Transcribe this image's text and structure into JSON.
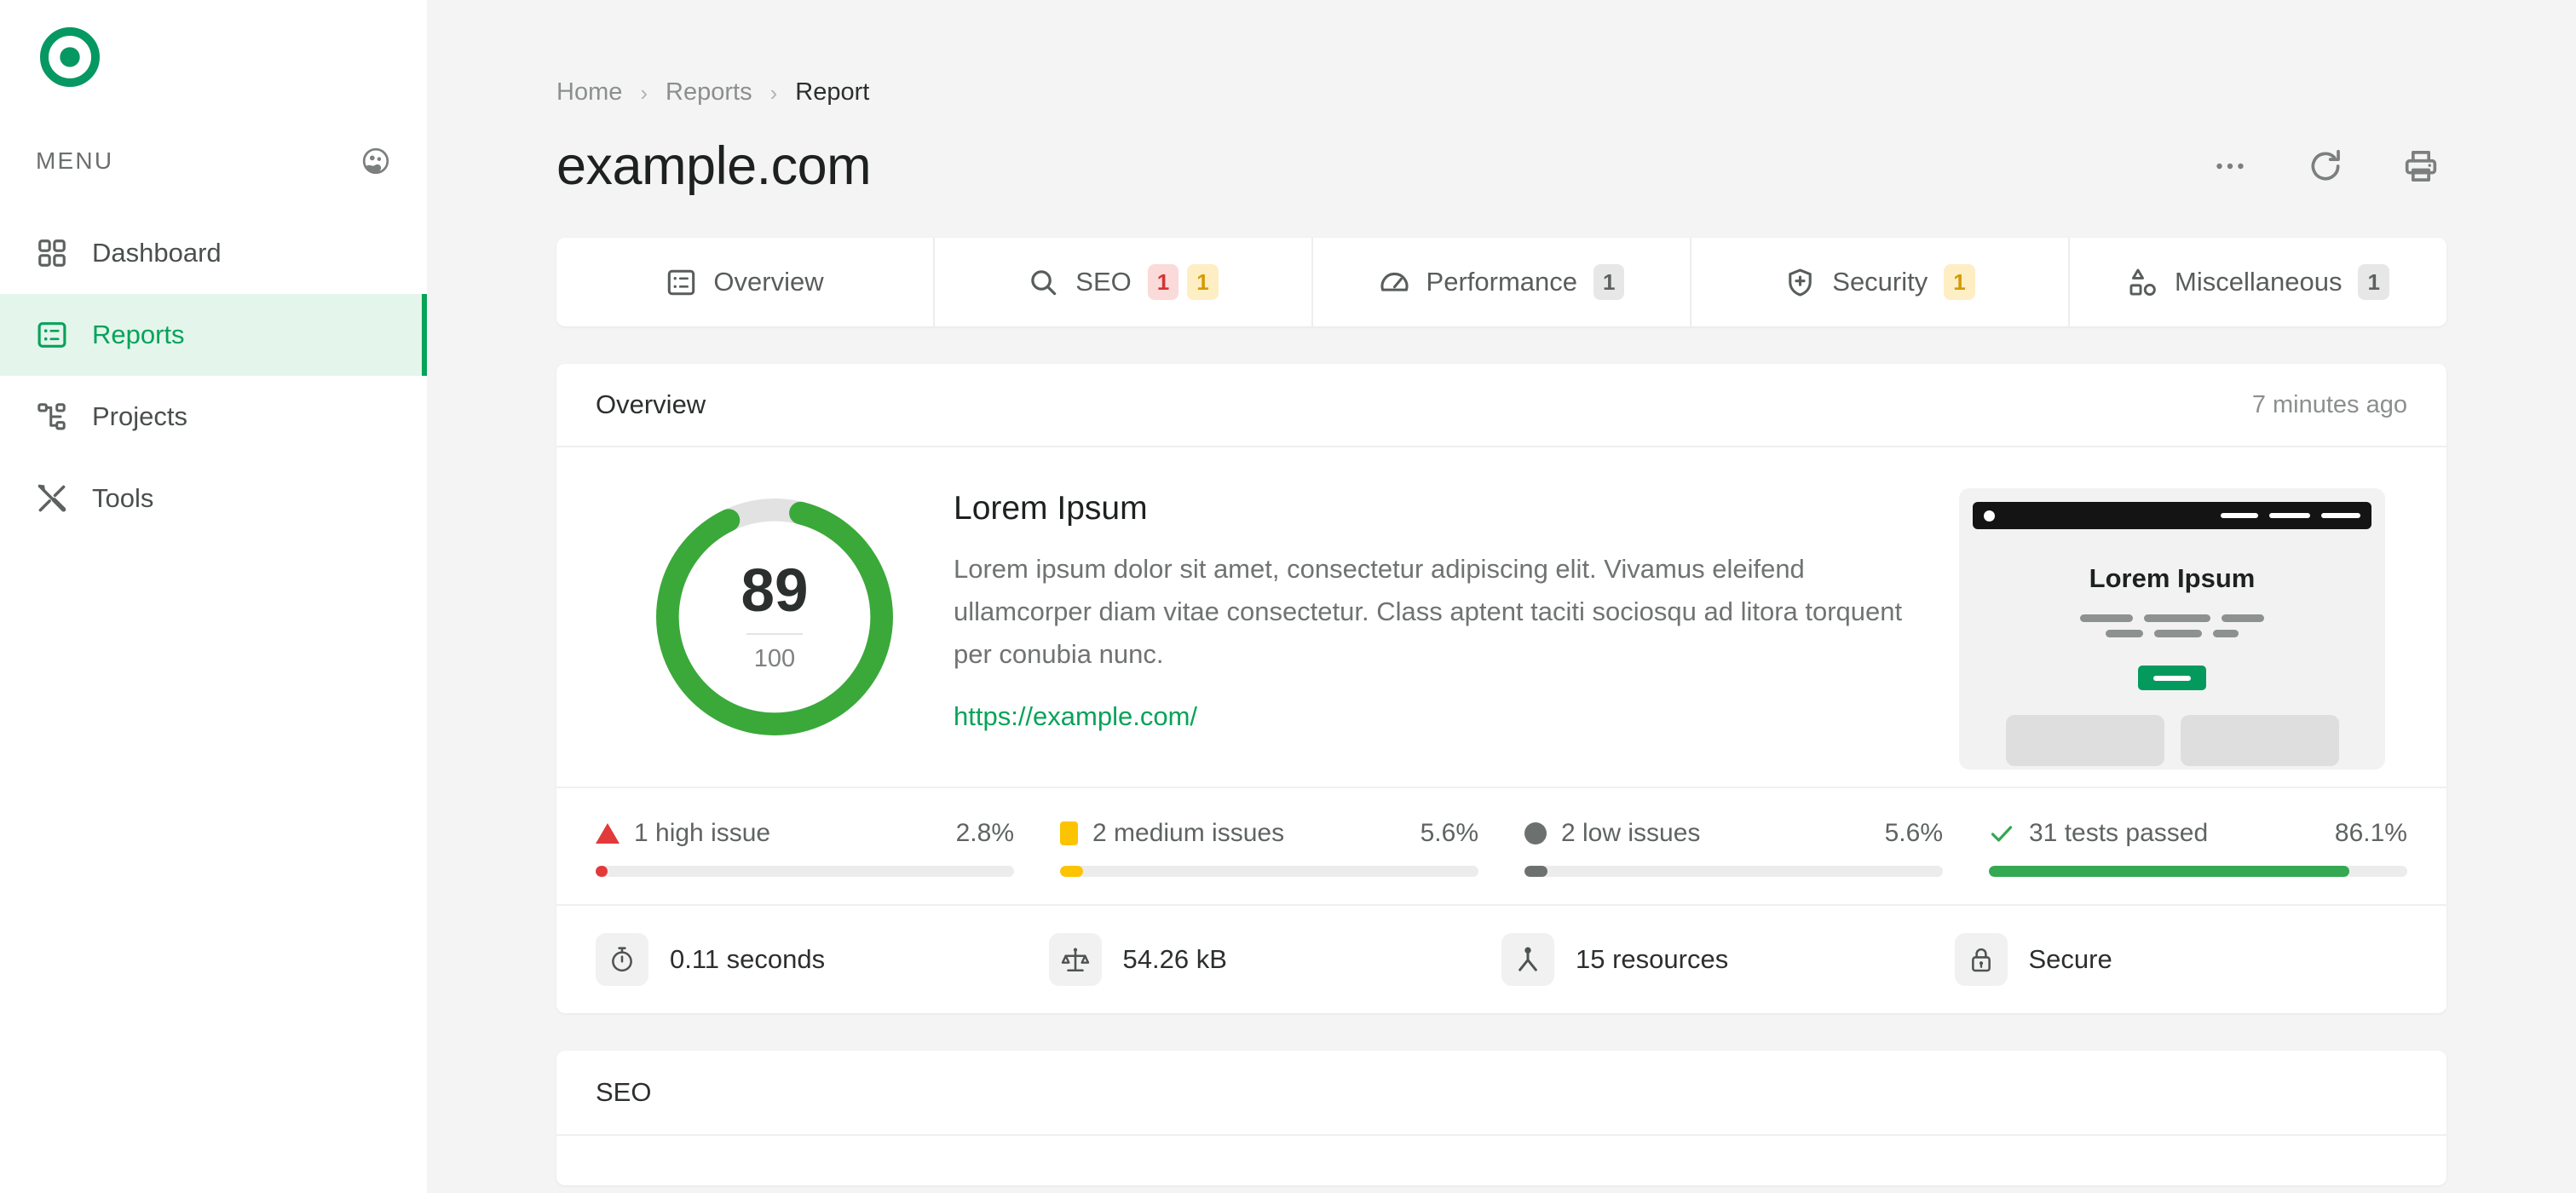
{
  "sidebar": {
    "logo_name": "target-logo",
    "menu_label": "MENU",
    "theme_icon": "theme-palette-icon",
    "items": [
      {
        "label": "Dashboard",
        "icon": "grid-icon",
        "active": false
      },
      {
        "label": "Reports",
        "icon": "list-box-icon",
        "active": true
      },
      {
        "label": "Projects",
        "icon": "sitemap-icon",
        "active": false
      },
      {
        "label": "Tools",
        "icon": "tools-icon",
        "active": false
      }
    ]
  },
  "breadcrumb": {
    "items": [
      "Home",
      "Reports",
      "Report"
    ],
    "separator": "›"
  },
  "header": {
    "title": "example.com",
    "actions": [
      {
        "name": "more-options-icon",
        "label": "More options"
      },
      {
        "name": "refresh-icon",
        "label": "Refresh"
      },
      {
        "name": "print-icon",
        "label": "Print"
      }
    ]
  },
  "tabs": [
    {
      "label": "Overview",
      "icon": "list-box-icon",
      "badges": []
    },
    {
      "label": "SEO",
      "icon": "search-icon",
      "badges": [
        {
          "value": "1",
          "tone": "red"
        },
        {
          "value": "1",
          "tone": "yellow"
        }
      ]
    },
    {
      "label": "Performance",
      "icon": "gauge-icon",
      "badges": [
        {
          "value": "1",
          "tone": "grey"
        }
      ]
    },
    {
      "label": "Security",
      "icon": "shield-icon",
      "badges": [
        {
          "value": "1",
          "tone": "yellow"
        }
      ]
    },
    {
      "label": "Miscellaneous",
      "icon": "shapes-icon",
      "badges": [
        {
          "value": "1",
          "tone": "grey"
        }
      ]
    }
  ],
  "overview_card": {
    "title": "Overview",
    "timestamp": "7 minutes ago",
    "score": {
      "value": "89",
      "max": "100",
      "percent": 89,
      "color": "#3aa93a",
      "track_color": "#e2e2e2"
    },
    "description": {
      "heading": "Lorem Ipsum",
      "body": "Lorem ipsum dolor sit amet, consectetur adipiscing elit. Vivamus eleifend ullamcorper diam vitae consectetur. Class aptent taciti sociosqu ad litora torquent per conubia nunc.",
      "link": "https://example.com/"
    },
    "preview": {
      "heading": "Lorem Ipsum",
      "accent_color": "#049a5d"
    },
    "issues": [
      {
        "label": "1 high issue",
        "percent_label": "2.8%",
        "percent": 2.8,
        "marker": "triangle-icon",
        "color": "#e23a3a"
      },
      {
        "label": "2 medium issues",
        "percent_label": "5.6%",
        "percent": 5.6,
        "marker": "square-icon",
        "color": "#fcc400"
      },
      {
        "label": "2 low issues",
        "percent_label": "5.6%",
        "percent": 5.6,
        "marker": "circle-icon",
        "color": "#6c716f"
      },
      {
        "label": "31 tests passed",
        "percent_label": "86.1%",
        "percent": 86.1,
        "marker": "check-icon",
        "color": "#34a853"
      }
    ],
    "metrics": [
      {
        "value": "0.11 seconds",
        "icon": "stopwatch-icon"
      },
      {
        "value": "54.26 kB",
        "icon": "scale-icon"
      },
      {
        "value": "15 resources",
        "icon": "resources-icon"
      },
      {
        "value": "Secure",
        "icon": "lock-icon"
      }
    ]
  },
  "seo_card": {
    "title": "SEO"
  }
}
